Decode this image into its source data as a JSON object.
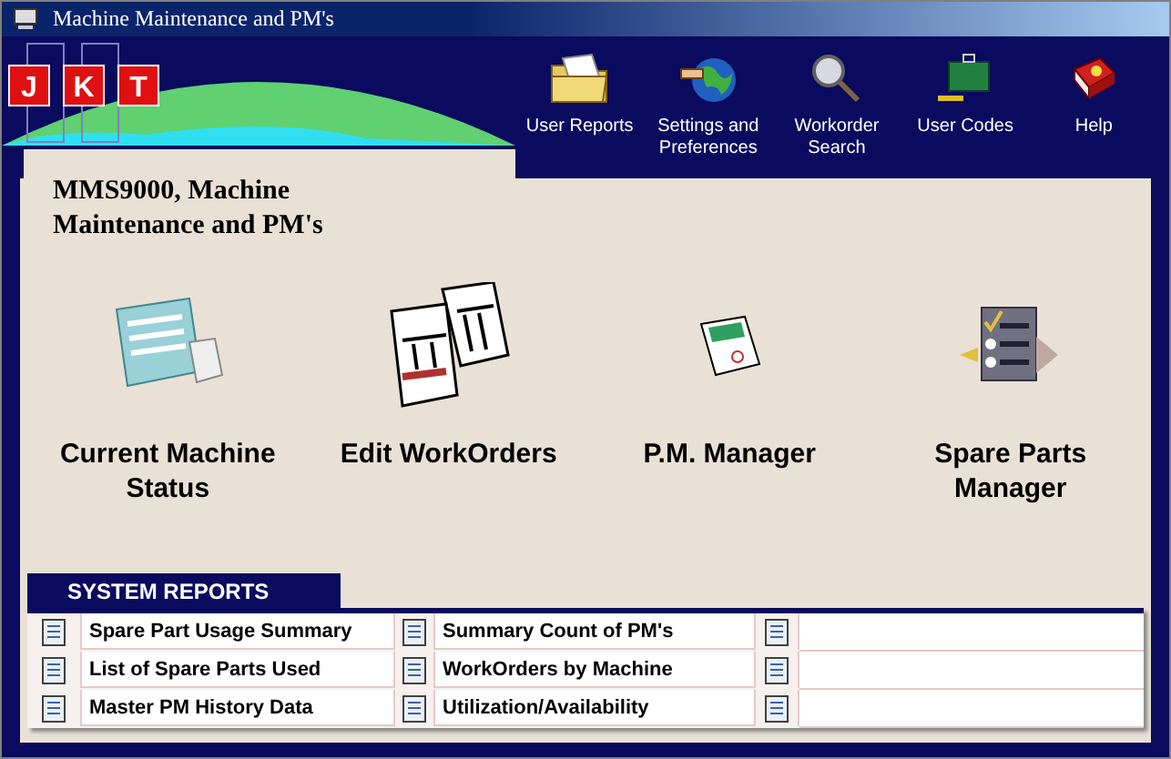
{
  "window": {
    "title": "Machine Maintenance and PM's"
  },
  "logo": {
    "letters": [
      "J",
      "K",
      "T"
    ]
  },
  "toolbar": [
    {
      "label": "User Reports",
      "kind": "folder"
    },
    {
      "label": "Settings and Preferences",
      "kind": "globe"
    },
    {
      "label": "Workorder Search",
      "kind": "magnifier"
    },
    {
      "label": "User Codes",
      "kind": "toolbox"
    },
    {
      "label": "Help",
      "kind": "book"
    }
  ],
  "heading": "MMS9000, Machine Maintenance and PM's",
  "features": [
    {
      "label": "Current Machine Status",
      "kind": "status"
    },
    {
      "label": "Edit WorkOrders",
      "kind": "workorders"
    },
    {
      "label": "P.M. Manager",
      "kind": "pm"
    },
    {
      "label": "Spare Parts Manager",
      "kind": "checklist"
    }
  ],
  "system_reports": {
    "title": "SYSTEM REPORTS",
    "rows": [
      {
        "reports": [
          "Spare Part Usage Summary",
          "Summary Count of PM's"
        ]
      },
      {
        "reports": [
          "List of Spare Parts Used",
          "WorkOrders by Machine"
        ]
      },
      {
        "reports": [
          "Master PM History Data",
          "Utilization/Availability"
        ]
      }
    ]
  }
}
